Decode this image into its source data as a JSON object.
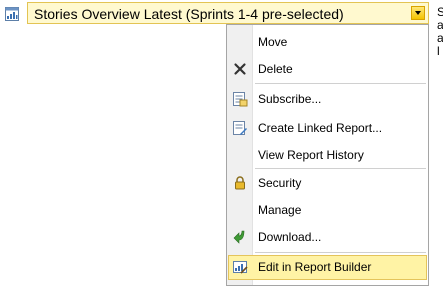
{
  "report": {
    "title": "Stories Overview Latest (Sprints 1-4 pre-selected)",
    "icon": "report-icon"
  },
  "side_text": [
    "S",
    "a",
    "a",
    "l"
  ],
  "menu": {
    "items": [
      {
        "label": "Move",
        "icon": null
      },
      {
        "label": "Delete",
        "icon": "delete-x-icon"
      },
      {
        "label": "Subscribe...",
        "icon": "subscribe-icon"
      },
      {
        "label": "Create Linked Report...",
        "icon": "linked-report-icon"
      },
      {
        "label": "View Report History",
        "icon": null
      },
      {
        "label": "Security",
        "icon": "lock-icon"
      },
      {
        "label": "Manage",
        "icon": null
      },
      {
        "label": "Download...",
        "icon": "download-arrow-icon"
      },
      {
        "label": "Edit in Report Builder",
        "icon": "report-builder-icon",
        "highlighted": true
      }
    ]
  },
  "colors": {
    "title_border": "#e3c453",
    "title_bg": "#fff9cf",
    "highlight_bg": "#fff3a5",
    "highlight_border": "#e4c45b"
  }
}
